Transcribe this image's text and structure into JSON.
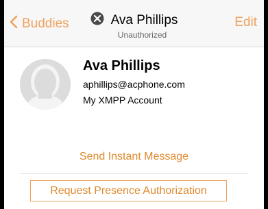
{
  "navbar": {
    "back_label": "Buddies",
    "title": "Ava Phillips",
    "subtitle": "Unauthorized",
    "edit_label": "Edit",
    "status_icon": "close-circle-icon",
    "accent_color": "#f0a15d"
  },
  "contact": {
    "name": "Ava Phillips",
    "email": "aphillips@acphone.com",
    "account": "My XMPP Account",
    "avatar_icon": "person-silhouette-icon"
  },
  "actions": {
    "send_message_label": "Send Instant Message",
    "request_presence_label": "Request Presence Authorization"
  }
}
